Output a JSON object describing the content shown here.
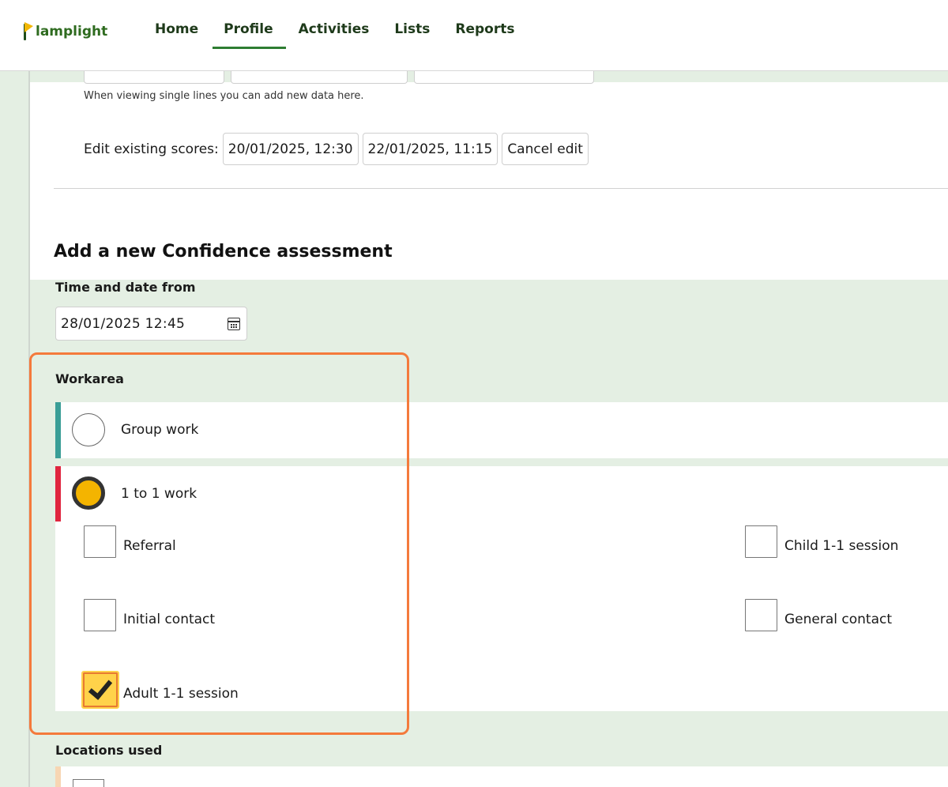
{
  "app": {
    "logo_text": "lamplight"
  },
  "nav": {
    "items": [
      {
        "label": "Home"
      },
      {
        "label": "Profile"
      },
      {
        "label": "Activities"
      },
      {
        "label": "Lists"
      },
      {
        "label": "Reports"
      }
    ],
    "active": "Profile"
  },
  "form": {
    "help_text": "When viewing single lines you can add new data here.",
    "edit_label": "Edit existing scores:",
    "edit_buttons": [
      {
        "label": "20/01/2025, 12:30"
      },
      {
        "label": "22/01/2025, 11:15"
      },
      {
        "label": "Cancel edit"
      }
    ],
    "section_title": "Add a new Confidence assessment",
    "time_label": "Time and date from",
    "time_value": "28/01/2025 12:45",
    "workarea_label": "Workarea",
    "workarea_options": [
      {
        "label": "Group work",
        "selected": false,
        "bar_color": "#3a9e97"
      },
      {
        "label": "1 to 1 work",
        "selected": true,
        "bar_color": "#e0253f"
      }
    ],
    "sub_options": [
      {
        "label": "Referral",
        "checked": false
      },
      {
        "label": "Child 1-1 session",
        "checked": false
      },
      {
        "label": "Initial contact",
        "checked": false
      },
      {
        "label": "General contact",
        "checked": false
      },
      {
        "label": "Adult 1-1 session",
        "checked": true
      }
    ],
    "locations_label": "Locations used"
  },
  "colors": {
    "accent_green": "#2e7d32",
    "panel_bg": "#e4efe3",
    "highlight": "#f47a3c",
    "radio_selected": "#f4b400"
  }
}
